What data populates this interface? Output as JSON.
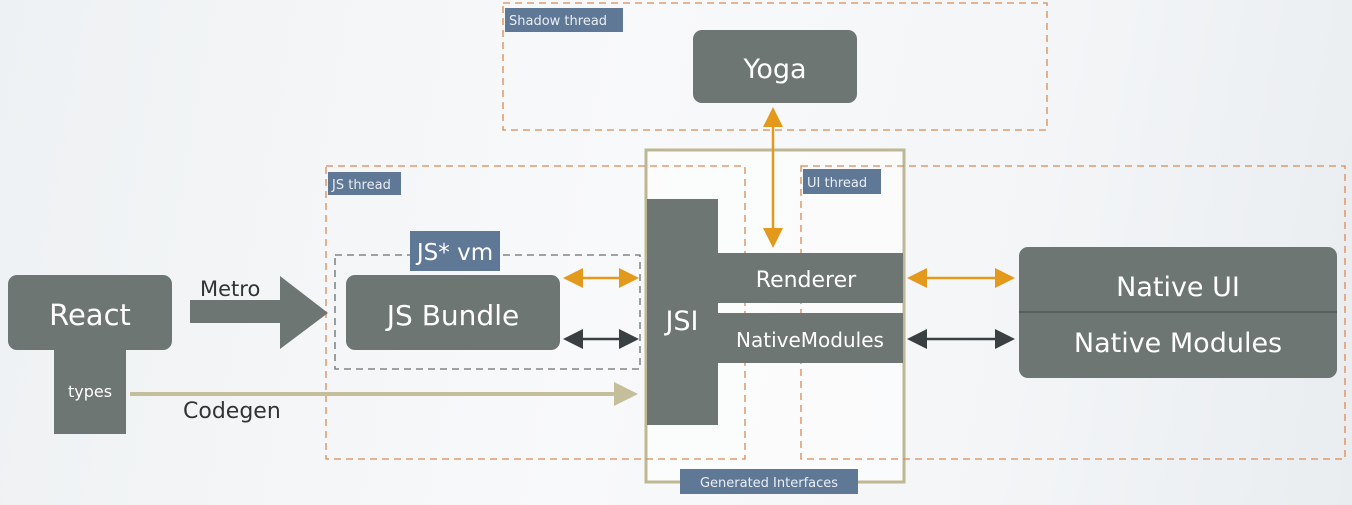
{
  "colors": {
    "box": "#6e7674",
    "label_bg": "#5f7896",
    "thread_border": "#d98a55",
    "generated_border": "#bdb793",
    "orange_arrow": "#e39a1c",
    "dark_arrow": "#3a3f42",
    "codegen_arrow": "#c4bf9a"
  },
  "threads": {
    "shadow": "Shadow thread",
    "js": "JS thread",
    "ui": "UI thread",
    "generated": "Generated Interfaces",
    "vm": "JS* vm"
  },
  "nodes": {
    "yoga": "Yoga",
    "react": "React",
    "types": "types",
    "js_bundle": "JS Bundle",
    "jsi": "JSI",
    "renderer": "Renderer",
    "native_modules_bar": "NativeModules",
    "native_ui": "Native UI",
    "native_modules": "Native Modules"
  },
  "edges": {
    "metro": "Metro",
    "codegen": "Codegen"
  }
}
